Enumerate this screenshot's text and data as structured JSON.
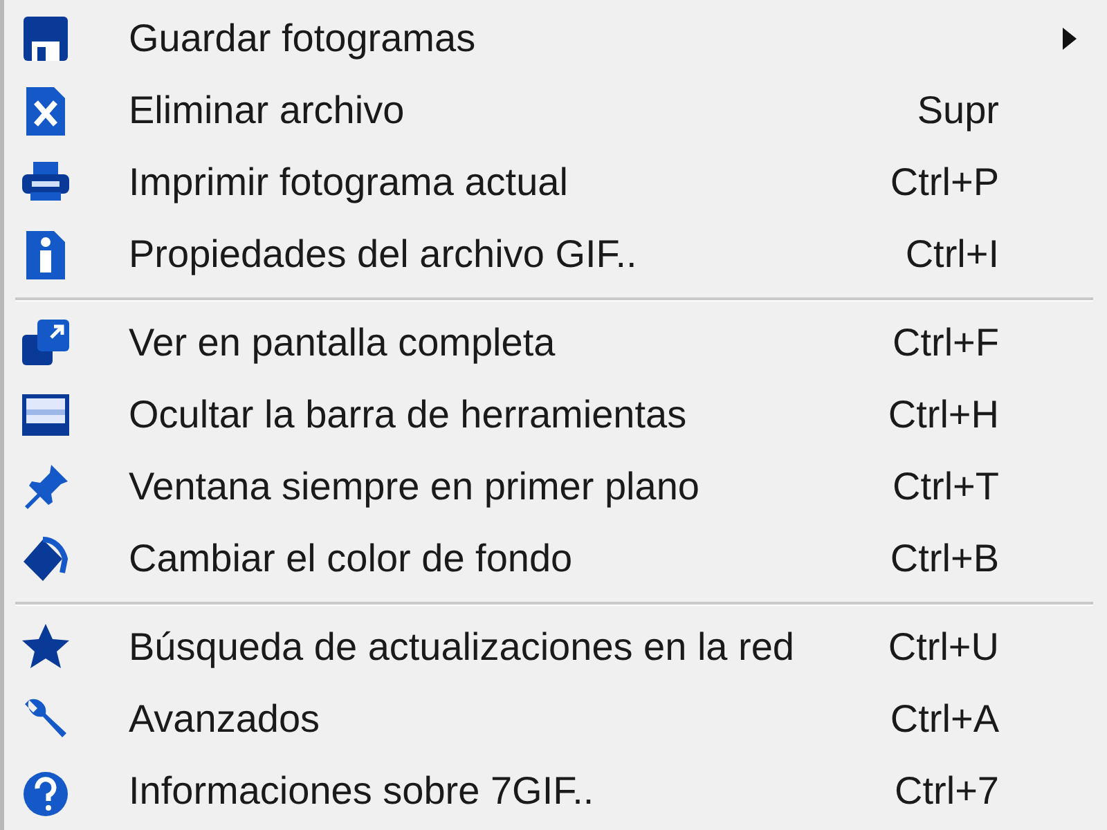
{
  "menu": {
    "entries": [
      {
        "kind": "item",
        "label": "Guardar fotogramas",
        "submenu": true
      },
      {
        "kind": "item",
        "label": "Eliminar archivo",
        "shortcut": "Supr"
      },
      {
        "kind": "item",
        "label": "Imprimir fotograma actual",
        "shortcut": "Ctrl+P"
      },
      {
        "kind": "item",
        "label": "Propiedades del archivo GIF..",
        "shortcut": "Ctrl+I"
      },
      {
        "kind": "separator"
      },
      {
        "kind": "item",
        "label": "Ver en pantalla completa",
        "shortcut": "Ctrl+F"
      },
      {
        "kind": "item",
        "label": "Ocultar la barra de herramientas",
        "shortcut": "Ctrl+H"
      },
      {
        "kind": "item",
        "label": "Ventana siempre en primer plano",
        "shortcut": "Ctrl+T"
      },
      {
        "kind": "item",
        "label": "Cambiar el color de fondo",
        "shortcut": "Ctrl+B"
      },
      {
        "kind": "separator"
      },
      {
        "kind": "item",
        "label": "Búsqueda de actualizaciones en la red",
        "shortcut": "Ctrl+U"
      },
      {
        "kind": "item",
        "label": "Avanzados",
        "shortcut": "Ctrl+A"
      },
      {
        "kind": "item",
        "label": "Informaciones sobre 7GIF..",
        "shortcut": "Ctrl+7"
      }
    ]
  }
}
